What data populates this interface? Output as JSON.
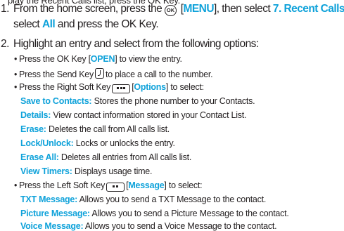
{
  "partial_top_line": "play the Recent Calls list, press the OK Key.",
  "step1": {
    "number": "1.",
    "text_a": "From the home screen, press the",
    "ok_key_label": "OK",
    "menu_open_bracket": " [",
    "menu": "MENU",
    "text_b": "], then select ",
    "recent_calls": "7. Recent Calls",
    "comma": ",",
    "text_c": "select ",
    "all": "All",
    "text_d": " and press the OK Key."
  },
  "step2": {
    "number": "2.",
    "text": "Highlight an entry and select from the following options:"
  },
  "bullet_open": {
    "text_a": "Press the OK Key [",
    "open": "OPEN",
    "text_b": "] to view the entry."
  },
  "bullet_send": {
    "text_a": "Press the Send Key",
    "text_b": "to place a call to the number."
  },
  "bullet_options": {
    "text_a": "Press the Right Soft Key",
    "bracket_open": "[",
    "options": "Options",
    "text_b": "] to select:"
  },
  "options_items": [
    {
      "term": "Save to Contacts:",
      "desc": " Stores the phone number to your Contacts."
    },
    {
      "term": "Details:",
      "desc": " View contact information stored in your Contact List."
    },
    {
      "term": "Erase:",
      "desc": " Deletes the call from All calls list."
    },
    {
      "term": "Lock/Unlock:",
      "desc": " Locks or unlocks the entry."
    },
    {
      "term": "Erase All:",
      "desc": " Deletes all entries from All calls list."
    },
    {
      "term": "View Timers:",
      "desc": " Displays usage time."
    }
  ],
  "bullet_message": {
    "text_a": "Press the Left Soft Key",
    "bracket_open": "[",
    "message": "Message",
    "text_b": "] to select:"
  },
  "message_items": [
    {
      "term": "TXT Message:",
      "desc": " Allows you to send a TXT Message to the contact."
    },
    {
      "term": "Picture Message:",
      "desc": " Allows you to send a Picture Message to the contact."
    },
    {
      "term": "Voice Message:",
      "desc": " Allows you to send a Voice Message to the contact."
    }
  ],
  "bullet_char": "•",
  "colors": {
    "accent": "#0fa2da",
    "text": "#231f20",
    "background": "#ffffff"
  },
  "icons": {
    "ok_key": "ok-key-icon",
    "send_key": "send-key-icon",
    "soft_key": "soft-key-icon"
  }
}
